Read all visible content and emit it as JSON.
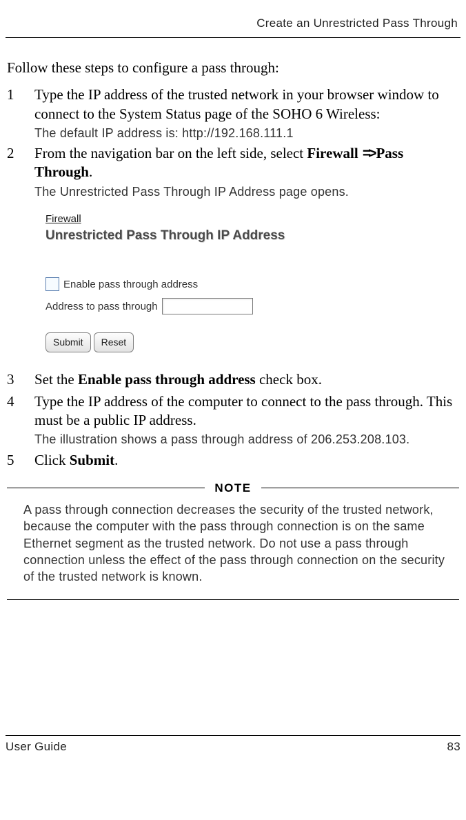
{
  "header": {
    "section_title": "Create an Unrestricted Pass Through"
  },
  "intro": "Follow these steps to configure a pass through:",
  "steps": {
    "s1": {
      "text_a": "Type the IP address of the trusted network in your browser window to connect to the System Status page of the SOHO 6 Wireless:",
      "annot": "The default IP address is: http://192.168.111.1"
    },
    "s2": {
      "text_a": "From the navigation bar on the left side, select ",
      "bold_a": "Firewall",
      "bold_b": "Pass Through",
      "text_b": ".",
      "annot": "The Unrestricted Pass Through IP Address page opens."
    },
    "s3": {
      "text_a": "Set the ",
      "bold_a": "Enable pass through address",
      "text_b": " check box."
    },
    "s4": {
      "text_a": "Type the IP address of the computer to connect to the pass through. This must be a public IP address.",
      "annot": "The illustration shows a pass through address of 206.253.208.103."
    },
    "s5": {
      "text_a": "Click ",
      "bold_a": "Submit",
      "text_b": "."
    }
  },
  "ui": {
    "breadcrumb": "Firewall",
    "page_title": "Unrestricted Pass Through IP Address",
    "enable_label": "Enable pass through address",
    "addr_label": "Address to pass through",
    "addr_value": "",
    "submit": "Submit",
    "reset": "Reset"
  },
  "note": {
    "label": "NOTE",
    "text": "A pass through connection decreases the security of the trusted network, because the computer with the pass through connection is on the same Ethernet segment as the trusted network. Do not use a pass through connection unless the effect of the pass through connection on the security of the trusted network is known."
  },
  "footer": {
    "left": "User Guide",
    "right": "83"
  }
}
